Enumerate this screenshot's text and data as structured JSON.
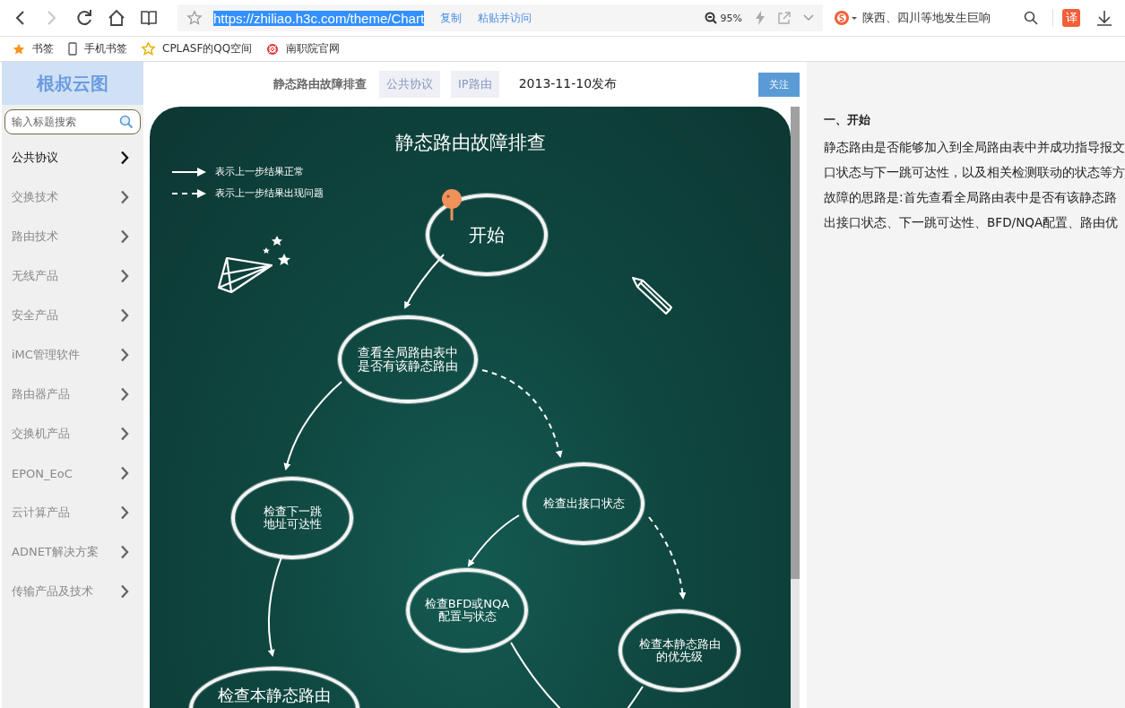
{
  "browser": {
    "nav": [
      {
        "kind": "back",
        "disabled": false
      },
      {
        "kind": "forward",
        "disabled": true
      },
      {
        "kind": "reload",
        "disabled": false
      },
      {
        "kind": "home",
        "disabled": false
      },
      {
        "kind": "reader",
        "disabled": false
      }
    ],
    "url": "https://zhiliao.h3c.com/theme/Chart",
    "url_actions": [
      "复制",
      "粘贴并访问"
    ],
    "zoom": "95%",
    "news": "陕西、四川等地发生巨响",
    "translate": "译"
  },
  "bookmarks": [
    {
      "kind": "star",
      "label": "书签"
    },
    {
      "kind": "phone",
      "label": "手机书签"
    },
    {
      "kind": "qzone",
      "label": "CPLASF的QQ空间"
    },
    {
      "kind": "ring",
      "label": "南职院官网"
    }
  ],
  "sidebar": {
    "logo": "根叔云图",
    "search": {
      "placeholder": "输入标题搜索"
    },
    "items": [
      {
        "label": "公共协议",
        "selected": true
      },
      {
        "label": "交换技术",
        "selected": false
      },
      {
        "label": "路由技术",
        "selected": false
      },
      {
        "label": "无线产品",
        "selected": false
      },
      {
        "label": "安全产品",
        "selected": false
      },
      {
        "label": "iMC管理软件",
        "selected": false
      },
      {
        "label": "路由器产品",
        "selected": false
      },
      {
        "label": "交换机产品",
        "selected": false
      },
      {
        "label": "EPON_EoC",
        "selected": false
      },
      {
        "label": "云计算产品",
        "selected": false
      },
      {
        "label": "ADNET解决方案",
        "selected": false
      },
      {
        "label": "传输产品及技术",
        "selected": false
      }
    ]
  },
  "article": {
    "title": "静态路由故障排查",
    "tags": [
      "公共协议",
      "IP路由"
    ],
    "date": "2013-11-10发布",
    "follow_button": "关注"
  },
  "diagram": {
    "title": "静态路由故障排查",
    "legend": [
      {
        "kind": "solid",
        "label": "表示上一步结果正常"
      },
      {
        "kind": "dashed",
        "label": "表示上一步结果出现问题"
      }
    ],
    "nodes": [
      {
        "text": "开始"
      },
      {
        "text": "查看全局路由表中是否有该静态路由"
      },
      {
        "text": "检查下一跳地址可达性"
      },
      {
        "text": "检查出接口状态"
      },
      {
        "text": "检查BFD或NQA配置与状态"
      },
      {
        "text": "检查本静态路由的优先级"
      },
      {
        "text": "检查本静态路由"
      }
    ],
    "edges": [
      {
        "kind": "solid"
      },
      {
        "kind": "solid"
      },
      {
        "kind": "dashed"
      },
      {
        "kind": "solid"
      },
      {
        "kind": "solid"
      },
      {
        "kind": "dashed"
      },
      {
        "kind": "solid"
      },
      {
        "kind": "solid"
      }
    ]
  },
  "detail": {
    "heading": "一、开始",
    "lines": [
      "静态路由是否能够加入到全局路由表中并成功指导报文",
      "口状态与下一跳可达性，以及相关检测联动的状态等方",
      "故障的思路是:首先查看全局路由表中是否有该静态路",
      "出接口状态、下一跳可达性、BFD/NQA配置、路由优"
    ]
  }
}
